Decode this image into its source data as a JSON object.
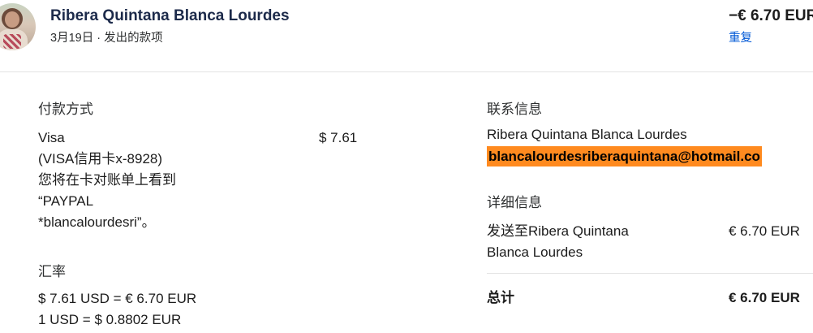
{
  "header": {
    "name": "Ribera Quintana Blanca Lourdes",
    "subtitle": "3月19日 · 发出的款项",
    "amount": "−€ 6.70 EUR",
    "repeat_label": "重复"
  },
  "payment": {
    "heading": "付款方式",
    "method": "Visa",
    "card": "(VISA信用卡x-8928)",
    "statement_line1": "您将在卡对账单上看到",
    "statement_line2": "“PAYPAL",
    "statement_line3": "*blancalourdesri”。",
    "amount": "$ 7.61"
  },
  "exchange": {
    "heading": "汇率",
    "line1": "$ 7.61 USD = € 6.70 EUR",
    "line2": "1 USD = $ 0.8802 EUR"
  },
  "contact": {
    "heading": "联系信息",
    "name": "Ribera Quintana Blanca Lourdes",
    "email": "blancalourdesriberaquintana@hotmail.co"
  },
  "details": {
    "heading": "详细信息",
    "sent_to_line1": "发送至Ribera Quintana",
    "sent_to_line2": "Blanca Lourdes",
    "sent_amount": "€ 6.70 EUR",
    "total_label": "总计",
    "total_amount": "€ 6.70 EUR"
  },
  "colors": {
    "link": "#0058d6",
    "highlight": "#ff8a1f",
    "name": "#1c2a4a"
  }
}
